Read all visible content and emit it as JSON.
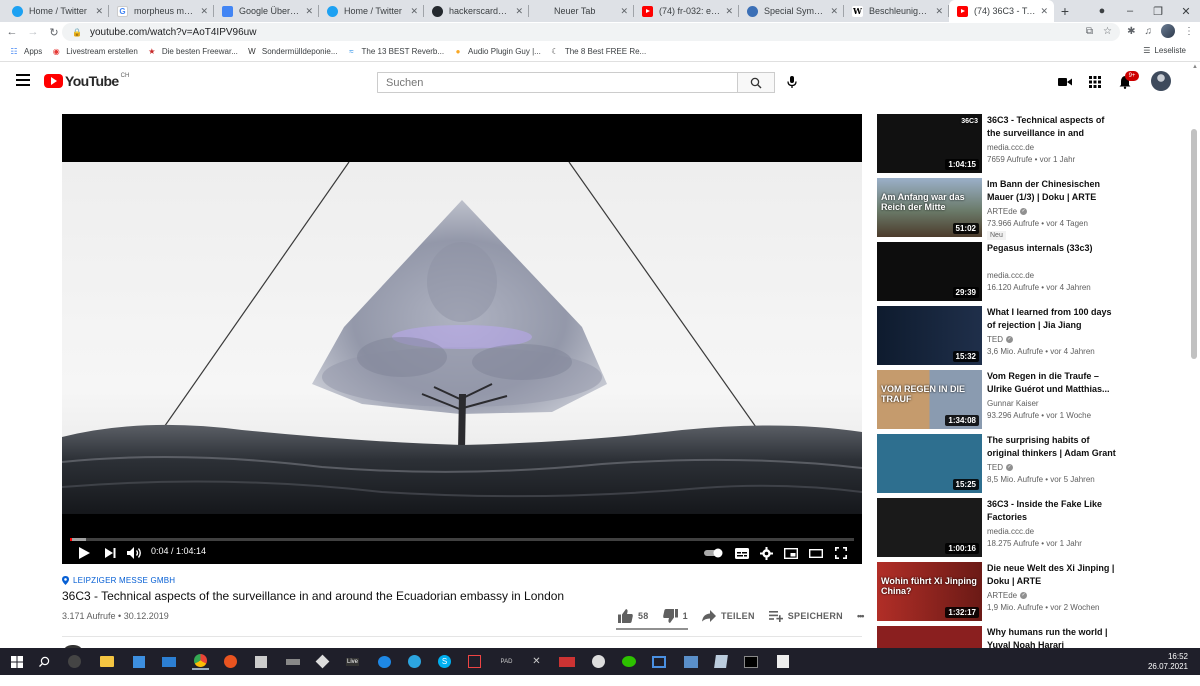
{
  "browser": {
    "tabs": [
      {
        "title": "Home / Twitter",
        "icon": "twitter-icon",
        "favicon": "twitter"
      },
      {
        "title": "morpheus matrix s",
        "icon": "google-icon",
        "favicon": "google",
        "glyph": "G"
      },
      {
        "title": "Google Übersetzer",
        "icon": "translate-icon",
        "favicon": "translate"
      },
      {
        "title": "Home / Twitter",
        "icon": "twitter-icon",
        "favicon": "twitter"
      },
      {
        "title": "hackerscardgame",
        "icon": "github-icon",
        "favicon": "github"
      },
      {
        "title": "Neuer Tab",
        "icon": "blank-icon",
        "favicon": "none"
      },
      {
        "title": "(74) fr-032: e.t. (Ed",
        "icon": "youtube-icon",
        "favicon": "yt"
      },
      {
        "title": "Special Symbols –",
        "icon": "globe-icon",
        "favicon": "special"
      },
      {
        "title": "Beschleunigung – ",
        "icon": "wikipedia-icon",
        "favicon": "wiki",
        "glyph": "W"
      },
      {
        "title": "(74) 36C3 - Techni",
        "icon": "youtube-icon",
        "favicon": "yt",
        "active": true
      }
    ],
    "new_tab_label": "+",
    "url": "youtube.com/watch?v=AoT4IPV96uw",
    "bookmarks": [
      {
        "label": "Apps",
        "icon": "apps-grid-icon"
      },
      {
        "label": "Livestream erstellen",
        "icon": "livestream-icon"
      },
      {
        "label": "Die besten Freewar...",
        "icon": "star-icon"
      },
      {
        "label": "Sondermülldeponie...",
        "icon": "w-logo-icon"
      },
      {
        "label": "The 13 BEST Reverb...",
        "icon": "plugin-icon"
      },
      {
        "label": "Audio Plugin Guy |...",
        "icon": "audio-plugin-icon"
      },
      {
        "label": "The 8 Best FREE Re...",
        "icon": "moon-icon"
      }
    ],
    "reading_list": "Leseliste"
  },
  "youtube": {
    "logo_text": "YouTube",
    "country_code": "CH",
    "search_placeholder": "Suchen",
    "notification_count": "9+"
  },
  "player": {
    "current_time": "0:04",
    "duration": "1:04:14",
    "time_display": "0:04 / 1:04:14",
    "progress_fraction": 0.001,
    "loaded_fraction": 0.02
  },
  "video": {
    "location": "LEIPZIGER MESSE GMBH",
    "title": "36C3 - Technical aspects of the surveillance in and around the Ecuadorian embassy in London",
    "meta": "3.171 Aufrufe • 30.12.2019",
    "likes": "58",
    "dislikes": "1",
    "share_label": "TEILEN",
    "save_label": "SPEICHERN",
    "more_label": "•••"
  },
  "recommendations": [
    {
      "title": "36C3 - Technical aspects of the surveillance in and aroun...",
      "channel": "media.ccc.de",
      "meta": "7659 Aufrufe • vor 1 Jahr",
      "duration": "1:04:15",
      "verified": false,
      "badge": "",
      "thumb_label": "36C3"
    },
    {
      "title": "Im Bann der Chinesischen Mauer (1/3) | Doku | ARTE",
      "channel": "ARTEde",
      "meta": "73.966 Aufrufe • vor 4 Tagen",
      "duration": "51:02",
      "verified": true,
      "badge": "Neu",
      "thumb_label": "Am Anfang war das Reich der Mitte"
    },
    {
      "title": "Pegasus internals (33c3)",
      "channel": "media.ccc.de",
      "meta": "16.120 Aufrufe • vor 4 Jahren",
      "duration": "29:39",
      "verified": false,
      "badge": "",
      "thumb_label": ""
    },
    {
      "title": "What I learned from 100 days of rejection | Jia Jiang",
      "channel": "TED",
      "meta": "3,6 Mio. Aufrufe • vor 4 Jahren",
      "duration": "15:32",
      "verified": true,
      "badge": "",
      "thumb_label": ""
    },
    {
      "title": "Vom Regen in die Traufe – Ulrike Guérot und Matthias...",
      "channel": "Gunnar Kaiser",
      "meta": "93.296 Aufrufe • vor 1 Woche",
      "duration": "1:34:08",
      "verified": false,
      "badge": "",
      "thumb_label": "VOM REGEN IN DIE TRAUF"
    },
    {
      "title": "The surprising habits of original thinkers | Adam Grant",
      "channel": "TED",
      "meta": "8,5 Mio. Aufrufe • vor 5 Jahren",
      "duration": "15:25",
      "verified": true,
      "badge": "",
      "thumb_label": ""
    },
    {
      "title": "36C3 - Inside the Fake Like Factories",
      "channel": "media.ccc.de",
      "meta": "18.275 Aufrufe • vor 1 Jahr",
      "duration": "1:00:16",
      "verified": false,
      "badge": "",
      "thumb_label": ""
    },
    {
      "title": "Die neue Welt des Xi Jinping | Doku | ARTE",
      "channel": "ARTEde",
      "meta": "1,9 Mio. Aufrufe • vor 2 Wochen",
      "duration": "1:32:17",
      "verified": true,
      "badge": "",
      "thumb_label": "Wohin führt Xi Jinping China?"
    },
    {
      "title": "Why humans run the world | Yuval Noah Harari",
      "channel": "",
      "meta": "",
      "duration": "",
      "verified": false,
      "badge": "",
      "thumb_label": ""
    }
  ],
  "taskbar": {
    "time": "16:52",
    "date": "26.07.2021"
  },
  "colors": {
    "yt_red": "#ff0000",
    "link_blue": "#065fd4",
    "taskbar_bg": "#1f1f2a",
    "tabstrip_bg": "#dee1e6"
  }
}
